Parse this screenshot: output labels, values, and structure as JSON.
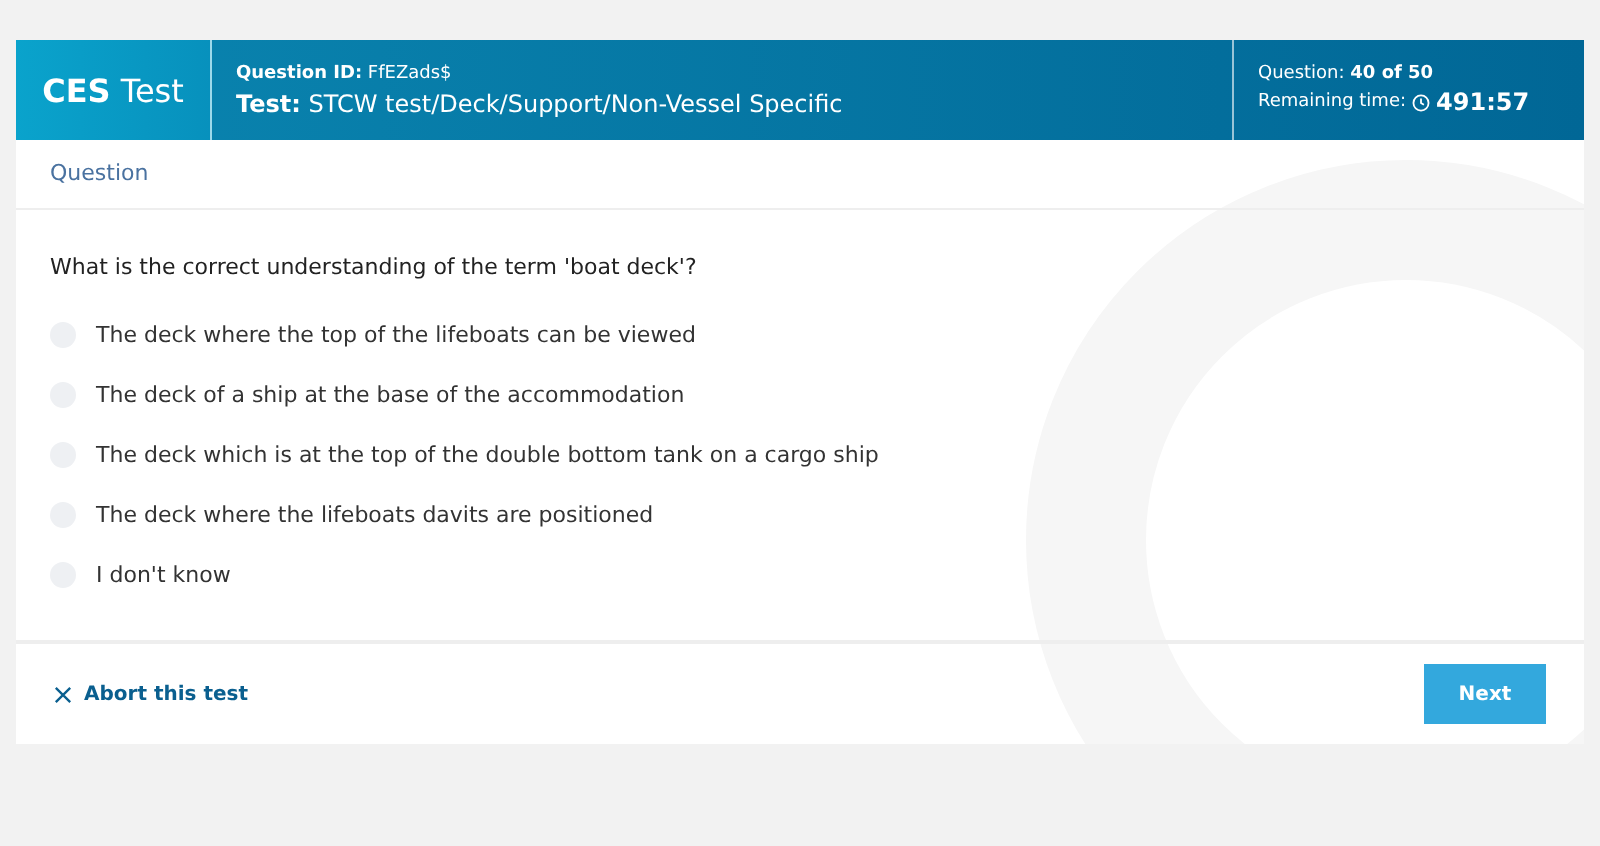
{
  "header": {
    "logo": "**CES** Test",
    "question_id": "**Question ID:** FfEZads$",
    "test": "**Test:** STCW test/Deck/Support/Non-Vessel Specific",
    "progress": "Question: **40 of 50**",
    "remaining_label": "Remaining time:",
    "remaining_time": "491:57"
  },
  "section_title": "Question",
  "question": "What is the correct understanding of the term 'boat deck'?",
  "options": [
    {
      "label": "The deck where the top of the lifeboats can be viewed",
      "selected": false
    },
    {
      "label": "The deck of a ship at the base of the accommodation",
      "selected": false
    },
    {
      "label": "The deck which is at the top of the double bottom tank on a cargo ship",
      "selected": false
    },
    {
      "label": "The deck where the lifeboats davits are positioned",
      "selected": false
    },
    {
      "label": "I don't know",
      "selected": false
    }
  ],
  "footer": {
    "abort": "Abort this test",
    "next": "Next"
  }
}
